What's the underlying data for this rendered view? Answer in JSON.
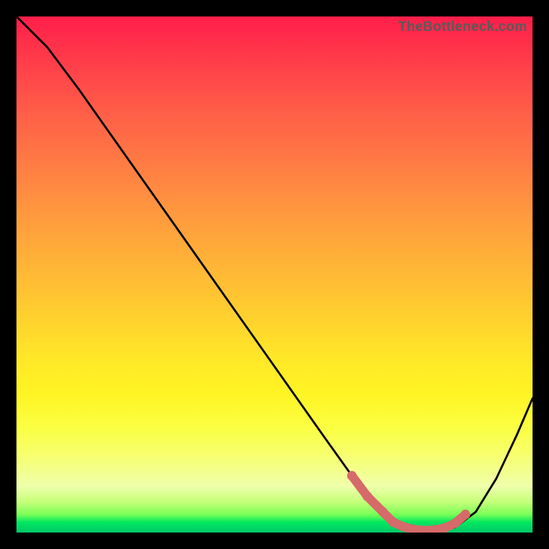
{
  "watermark": "TheBottleneck.com",
  "chart_data": {
    "type": "line",
    "title": "",
    "xlabel": "",
    "ylabel": "",
    "xlim": [
      0,
      100
    ],
    "ylim": [
      0,
      100
    ],
    "grid": false,
    "series": [
      {
        "name": "main-curve",
        "color": "#000000",
        "x": [
          0,
          6,
          12,
          18,
          24,
          30,
          36,
          42,
          48,
          54,
          60,
          65,
          69,
          73,
          76,
          79,
          82,
          85,
          89,
          93,
          97,
          100
        ],
        "y": [
          100,
          94,
          86,
          77.5,
          69,
          60.5,
          52,
          43.5,
          35,
          26.5,
          18,
          11,
          5.5,
          2,
          0.7,
          0.3,
          0.4,
          1,
          4,
          10.5,
          19,
          26
        ]
      },
      {
        "name": "marker-band",
        "color": "#d66a6a",
        "x": [
          65,
          68,
          71,
          73,
          75,
          77,
          79,
          81,
          83,
          85,
          87
        ],
        "y": [
          11,
          7,
          4,
          2,
          1.1,
          0.6,
          0.4,
          0.5,
          0.9,
          1.8,
          3.5
        ]
      }
    ],
    "background_gradient": {
      "stops": [
        {
          "offset": 0.0,
          "color": "#ff1e4a"
        },
        {
          "offset": 0.28,
          "color": "#ff7a44"
        },
        {
          "offset": 0.58,
          "color": "#ffd02e"
        },
        {
          "offset": 0.8,
          "color": "#fbff44"
        },
        {
          "offset": 0.94,
          "color": "#c6ff7a"
        },
        {
          "offset": 1.0,
          "color": "#00c86a"
        }
      ]
    }
  }
}
